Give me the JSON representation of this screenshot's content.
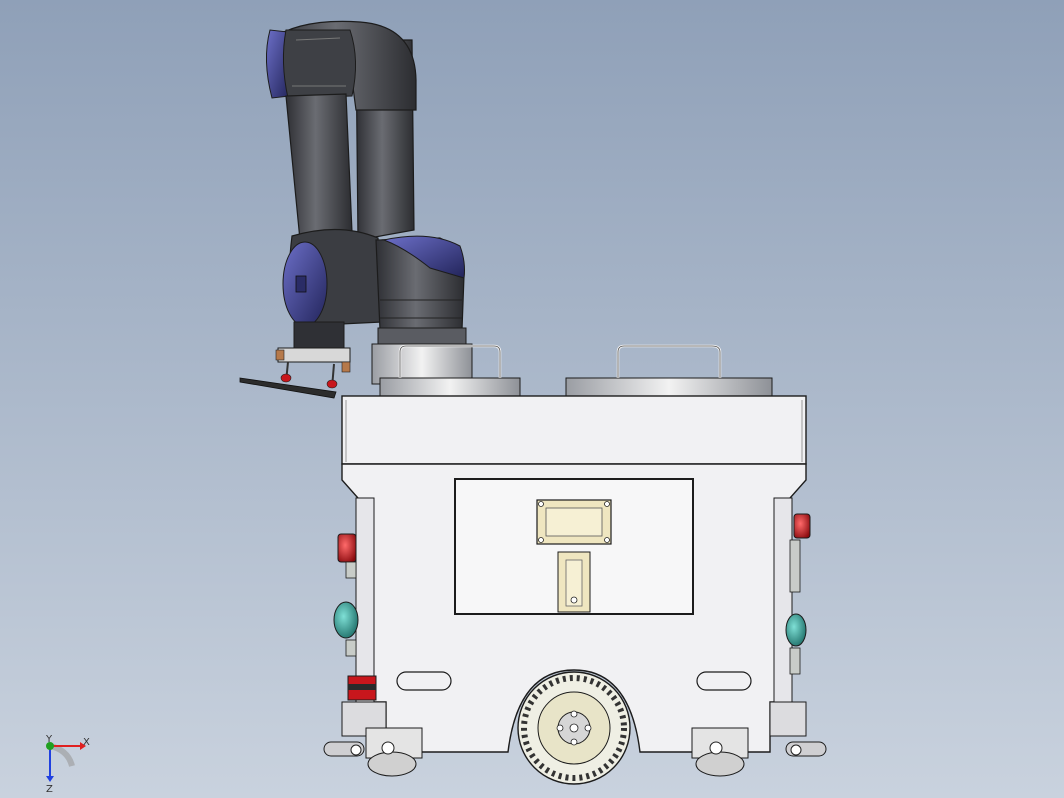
{
  "scene": {
    "background_top": "#8fa0b8",
    "background_bottom": "#c9d2de",
    "arm_color": "#4a4c52",
    "joint_cap_color": "#3c3f8c",
    "body_color": "#f1f1f3",
    "outline_color": "#1c1c1c"
  },
  "triad": {
    "x_label": "X",
    "y_label": "Y",
    "z_label": "Z",
    "x_color": "#e02020",
    "y_color": "#20a020",
    "z_color": "#2040e0"
  },
  "buttons": {
    "estop_color": "#c8161c",
    "start_color": "#2a9a90"
  }
}
